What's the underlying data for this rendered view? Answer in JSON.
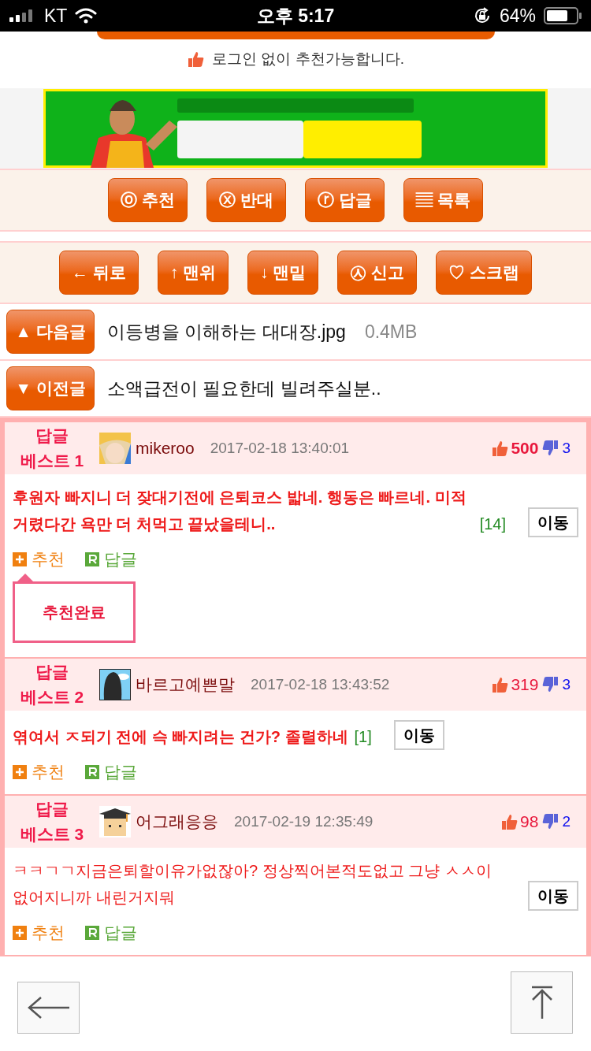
{
  "status_bar": {
    "carrier": "KT",
    "time": "오후 5:17",
    "battery": "64%"
  },
  "notice": "로그인 없이 추천가능합니다.",
  "ad_banner": {
    "kind": "picture"
  },
  "vote_buttons": [
    "ⓞ 추천",
    "ⓧ 반대",
    "ⓡ 답글",
    "▤ 목록"
  ],
  "nav_buttons": [
    "← 뒤로",
    "↑ 맨위",
    "↓ 맨밑",
    "㉦ 신고",
    "♡ 스크랩"
  ],
  "adjacent_posts": [
    {
      "button": "▲ 다음글",
      "title": "이등병을 이해하는 대대장.jpg",
      "size": "0.4MB"
    },
    {
      "button": "▼ 이전글",
      "title": "소액급전이 필요한데 빌려주실분.."
    }
  ],
  "best_comments": [
    {
      "label": "답글 베스트 1",
      "author": "mikeroo",
      "date": "2017-02-18 13:40:01",
      "likes": "500",
      "likes_bold": true,
      "dislikes": "3",
      "text": "후원자 빠지니 더 잦대기전에 은퇴코스 밟네. 행동은 빠르네. 미적거렸다간 욕만 더 처먹고 끝났을테니..",
      "text_bold": true,
      "reply_count": "[14]",
      "move": "이동",
      "recommend": "추천",
      "reply": "답글",
      "tooltip": "추천완료"
    },
    {
      "label": "답글 베스트 2",
      "author": "바르고예쁜말",
      "date": "2017-02-18 13:43:52",
      "likes": "319",
      "likes_bold": false,
      "dislikes": "3",
      "text": "엮여서 ㅈ되기 전에 슥 빠지려는 건가? 졸렬하네",
      "text_bold": true,
      "reply_count": "[1]",
      "move": "이동",
      "recommend": "추천",
      "reply": "답글"
    },
    {
      "label": "답글 베스트 3",
      "author": "어그래응응",
      "date": "2017-02-19 12:35:49",
      "likes": "98",
      "likes_bold": false,
      "dislikes": "2",
      "text": "ㅋㅋㄱㄱ지금은퇴할이유가없잖아? 정상찍어본적도없고 그냥 ㅅㅅ이없어지니까 내린거지뭐",
      "text_bold": false,
      "move": "이동",
      "recommend": "추천",
      "reply": "답글"
    }
  ]
}
